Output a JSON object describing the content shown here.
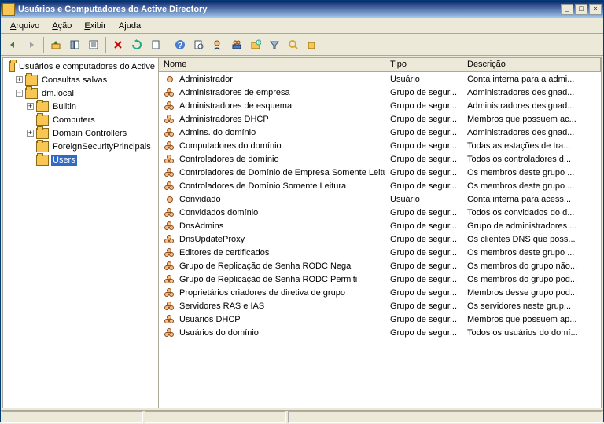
{
  "titlebar": {
    "text": "Usuários e Computadores do Active Directory"
  },
  "menus": [
    "Arquivo",
    "Ação",
    "Exibir",
    "Ajuda"
  ],
  "tree": {
    "root": "Usuários e computadores do Active",
    "saved": "Consultas salvas",
    "domain": "dm.local",
    "children": [
      "Builtin",
      "Computers",
      "Domain Controllers",
      "ForeignSecurityPrincipals",
      "Users"
    ]
  },
  "columns": {
    "name": "Nome",
    "type": "Tipo",
    "desc": "Descrição"
  },
  "rows": [
    {
      "n": "Administrador",
      "t": "Usuário",
      "d": "Conta interna para a admi...",
      "k": "user"
    },
    {
      "n": "Administradores de empresa",
      "t": "Grupo de segur...",
      "d": "Administradores designad...",
      "k": "group"
    },
    {
      "n": "Administradores de esquema",
      "t": "Grupo de segur...",
      "d": "Administradores designad...",
      "k": "group"
    },
    {
      "n": "Administradores DHCP",
      "t": "Grupo de segur...",
      "d": "Membros que possuem ac...",
      "k": "group"
    },
    {
      "n": "Admins. do domínio",
      "t": "Grupo de segur...",
      "d": "Administradores designad...",
      "k": "group"
    },
    {
      "n": "Computadores do domínio",
      "t": "Grupo de segur...",
      "d": "Todas as estações de tra...",
      "k": "group"
    },
    {
      "n": "Controladores de domínio",
      "t": "Grupo de segur...",
      "d": "Todos os controladores d...",
      "k": "group"
    },
    {
      "n": "Controladores de Domínio de Empresa Somente Leitura",
      "t": "Grupo de segur...",
      "d": "Os membros deste grupo ...",
      "k": "group"
    },
    {
      "n": "Controladores de Domínio Somente Leitura",
      "t": "Grupo de segur...",
      "d": "Os membros deste grupo ...",
      "k": "group"
    },
    {
      "n": "Convidado",
      "t": "Usuário",
      "d": "Conta interna para acess...",
      "k": "user"
    },
    {
      "n": "Convidados domínio",
      "t": "Grupo de segur...",
      "d": "Todos os convidados do d...",
      "k": "group"
    },
    {
      "n": "DnsAdmins",
      "t": "Grupo de segur...",
      "d": "Grupo de administradores ...",
      "k": "group"
    },
    {
      "n": "DnsUpdateProxy",
      "t": "Grupo de segur...",
      "d": "Os clientes DNS que poss...",
      "k": "group"
    },
    {
      "n": "Editores de certificados",
      "t": "Grupo de segur...",
      "d": "Os membros deste grupo ...",
      "k": "group"
    },
    {
      "n": "Grupo de Replicação de Senha RODC Nega",
      "t": "Grupo de segur...",
      "d": "Os membros do grupo não...",
      "k": "group"
    },
    {
      "n": "Grupo de Replicação de Senha RODC Permiti",
      "t": "Grupo de segur...",
      "d": "Os membros do grupo pod...",
      "k": "group"
    },
    {
      "n": "Proprietários criadores de diretiva de grupo",
      "t": "Grupo de segur...",
      "d": "Membros desse grupo pod...",
      "k": "group"
    },
    {
      "n": "Servidores RAS e IAS",
      "t": "Grupo de segur...",
      "d": "Os servidores neste grup...",
      "k": "group"
    },
    {
      "n": "Usuários DHCP",
      "t": "Grupo de segur...",
      "d": "Membros que possuem ap...",
      "k": "group"
    },
    {
      "n": "Usuários do domínio",
      "t": "Grupo de segur...",
      "d": "Todos os usuários do domí...",
      "k": "group"
    }
  ]
}
